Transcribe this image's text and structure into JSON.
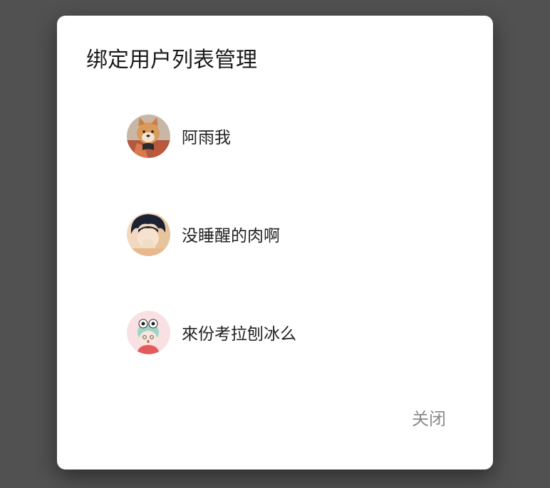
{
  "dialog": {
    "title": "绑定用户列表管理",
    "close_label": "关闭"
  },
  "users": [
    {
      "name": "阿雨我",
      "avatar_icon": "shiba-dog-avatar-icon"
    },
    {
      "name": "没睡醒的肉啊",
      "avatar_icon": "anime-boy-avatar-icon"
    },
    {
      "name": "來份考拉刨冰么",
      "avatar_icon": "cartoon-frog-hat-avatar-icon"
    }
  ],
  "colors": {
    "backdrop": "#515151",
    "dialog_bg": "#ffffff",
    "title_text": "#1a1a1a",
    "name_text": "#222222",
    "close_text": "#8a8a8a"
  }
}
